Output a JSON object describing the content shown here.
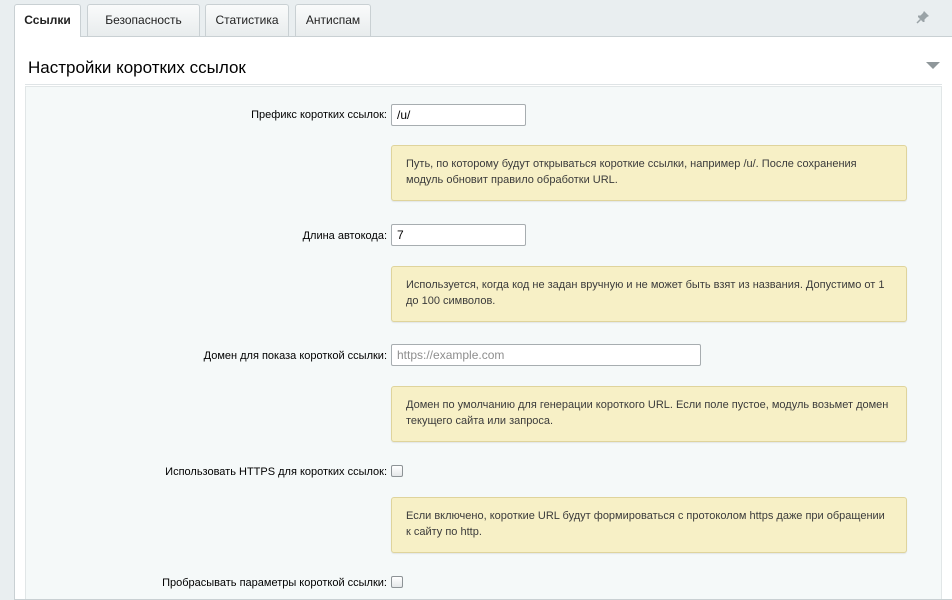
{
  "tabs": [
    {
      "label": "Ссылки",
      "active": true
    },
    {
      "label": "Безопасность",
      "active": false
    },
    {
      "label": "Статистика",
      "active": false
    },
    {
      "label": "Антиспам",
      "active": false
    }
  ],
  "pin_icon": "pin-icon",
  "section": {
    "title": "Настройки коротких ссылок",
    "collapse_icon": "triangle-down-icon"
  },
  "fields": {
    "prefix": {
      "label": "Префикс коротких ссылок:",
      "value": "/u/",
      "hint": "Путь, по которому будут открываться короткие ссылки, например /u/. После сохранения модуль обновит правило обработки URL."
    },
    "autocode_length": {
      "label": "Длина автокода:",
      "value": "7",
      "hint": "Используется, когда код не задан вручную и не может быть взят из названия. Допустимо от 1 до 100 символов."
    },
    "domain": {
      "label": "Домен для показа короткой ссылки:",
      "value": "",
      "placeholder": "https://example.com",
      "hint": "Домен по умолчанию для генерации короткого URL. Если поле пустое, модуль возьмет домен текущего сайта или запроса."
    },
    "use_https": {
      "label": "Использовать HTTPS для коротких ссылок:",
      "checked": false,
      "hint": "Если включено, короткие URL будут формироваться с протоколом https даже при обращении к сайту по http."
    },
    "forward_params": {
      "label": "Пробрасывать параметры короткой ссылки:",
      "checked": false
    }
  },
  "colors": {
    "hint_bg": "#f7f0c6",
    "form_bg": "#f5f9f9",
    "page_bg": "#e9eef0"
  }
}
